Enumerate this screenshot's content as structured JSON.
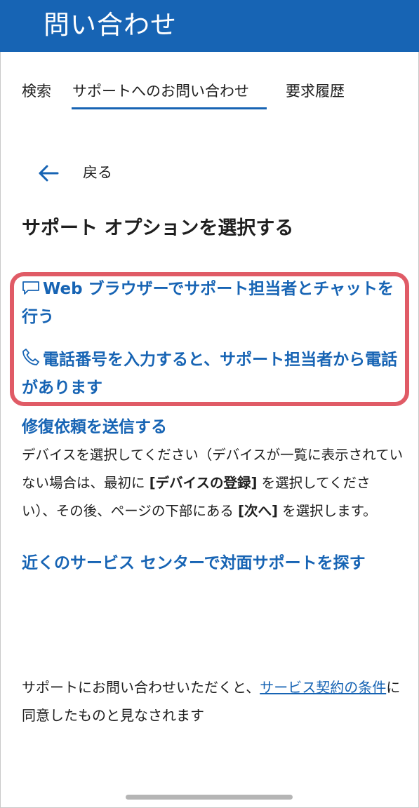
{
  "app": {
    "title": "問い合わせ"
  },
  "tabs": [
    {
      "label": "検索"
    },
    {
      "label": "サポートへのお問い合わせ"
    },
    {
      "label": "要求履歴"
    }
  ],
  "back": {
    "label": "戻る",
    "icon": "arrow-left-icon"
  },
  "heading": "サポート オプションを選択する",
  "options": {
    "chat": {
      "icon": "chat-bubble-icon",
      "label": "Web ブラウザーでサポート担当者とチャットを行う"
    },
    "phone": {
      "icon": "phone-icon",
      "label": "電話番号を入力すると、サポート担当者から電話があります"
    },
    "repair": {
      "label": "修復依頼を送信する",
      "desc_part1": "デバイスを選択してください（デバイスが一覧に表示されていない場合は、最初に ",
      "desc_bold1": "[デバイスの登録]",
      "desc_part2": " を選択してください）、その後、ページの下部にある ",
      "desc_bold2": "[次へ]",
      "desc_part3": " を選択します。"
    },
    "nearby": {
      "label": "近くのサービス センターで対面サポートを探す"
    }
  },
  "footer": {
    "text_before": "サポートにお問い合わせいただくと、",
    "link": "サービス契約の条件",
    "text_after": "に同意したものと見なされます"
  },
  "colors": {
    "appbar": "#1764b4",
    "link": "#1764b4",
    "highlight": "#e05b66"
  }
}
